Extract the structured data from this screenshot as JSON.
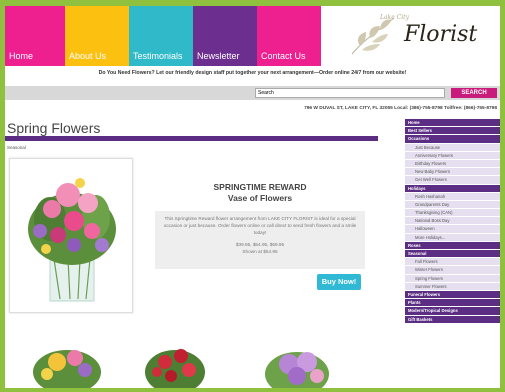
{
  "nav": {
    "items": [
      {
        "label": "Home",
        "color": "#ee1f8f"
      },
      {
        "label": "About Us",
        "color": "#fcc010"
      },
      {
        "label": "Testimonials",
        "color": "#2fb9c9"
      },
      {
        "label": "Newsletter",
        "color": "#6c2f8f"
      },
      {
        "label": "Contact Us",
        "color": "#ee1f8f"
      }
    ]
  },
  "logo": {
    "sub": "Lake City",
    "text": "Florist"
  },
  "tagline": "Do You Need Flowers? Let our friendly design staff put together your next arrangement—Order online 24/7 from our website!",
  "search": {
    "value": "Search",
    "button": "SEARCH"
  },
  "address": "796 W DUVAL ST, LAKE CITY, FL 32055   Local: (386)-755-8798   Tollfree: (866)-755-8798",
  "main": {
    "heading": "Spring Flowers",
    "breadcrumb": "Seasonal",
    "product": {
      "title_line1": "SPRINGTIME REWARD",
      "title_line2": "Vase of Flowers",
      "description": "This Springtime Reward flower arrangement from LAKE CITY FLORIST is ideal for a special occasion or just because. Order flowers online or call direct to send fresh flowers and a smile today!",
      "prices": "$39.95, $54.95, $69.95",
      "shown_at": "Shown at $54.95",
      "buy_label": "Buy Now!"
    }
  },
  "sidebar": {
    "items": [
      {
        "label": "Home",
        "type": "head"
      },
      {
        "label": "Best Sellers",
        "type": "head"
      },
      {
        "label": "Occasions",
        "type": "head"
      },
      {
        "label": "Just Because",
        "type": "sub"
      },
      {
        "label": "Anniversary Flowers",
        "type": "sub"
      },
      {
        "label": "Birthday Flowers",
        "type": "sub"
      },
      {
        "label": "New Baby Flowers",
        "type": "sub"
      },
      {
        "label": "Get Well Flowers",
        "type": "sub"
      },
      {
        "label": "Holidays",
        "type": "head"
      },
      {
        "label": "Rosh Hashanah",
        "type": "sub"
      },
      {
        "label": "Grandparents Day",
        "type": "sub"
      },
      {
        "label": "Thanksgiving (CAN)",
        "type": "sub"
      },
      {
        "label": "National Boss Day",
        "type": "sub"
      },
      {
        "label": "Halloween",
        "type": "sub"
      },
      {
        "label": "More Holidays...",
        "type": "sub"
      },
      {
        "label": "Roses",
        "type": "head"
      },
      {
        "label": "Seasonal",
        "type": "head"
      },
      {
        "label": "Fall Flowers",
        "type": "sub"
      },
      {
        "label": "Winter Flowers",
        "type": "sub"
      },
      {
        "label": "Spring Flowers",
        "type": "sub"
      },
      {
        "label": "Summer Flowers",
        "type": "sub"
      },
      {
        "label": "Funeral Flowers",
        "type": "head"
      },
      {
        "label": "Plants",
        "type": "head"
      },
      {
        "label": "Modern/Tropical Designs",
        "type": "head"
      },
      {
        "label": "Gift Baskets",
        "type": "head"
      }
    ]
  }
}
